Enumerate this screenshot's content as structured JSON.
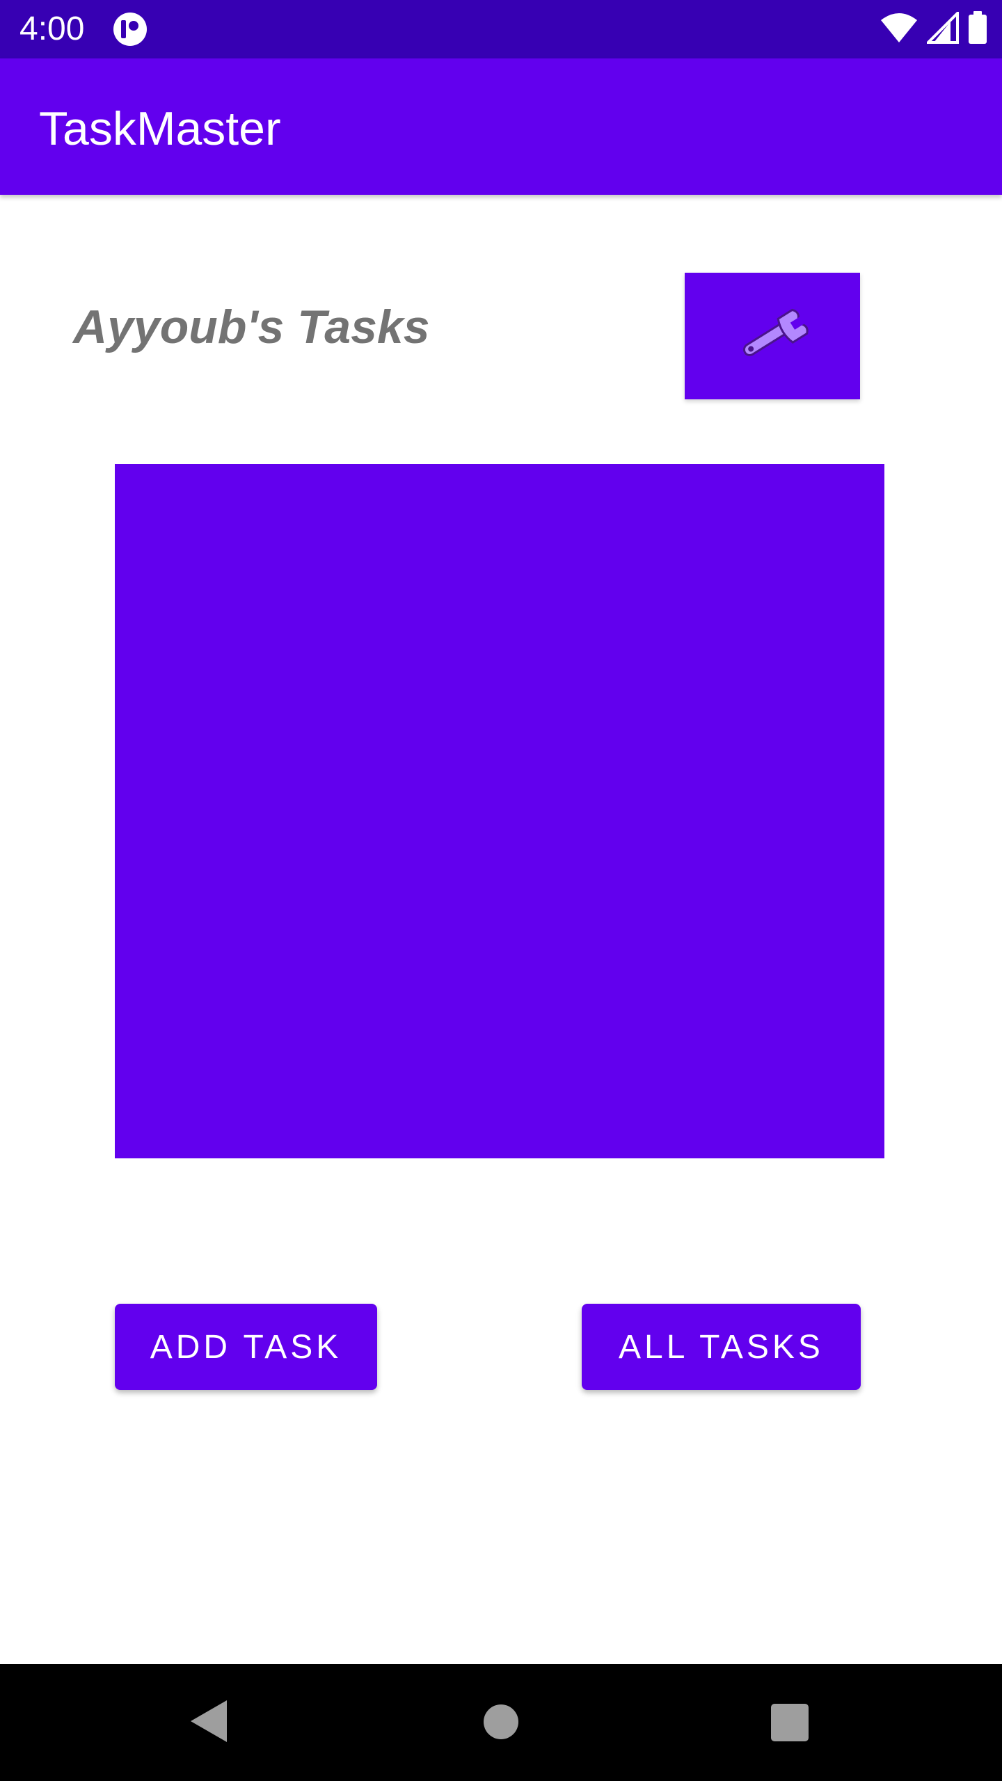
{
  "status_bar": {
    "time": "4:00",
    "background": "#3700b3",
    "icons": [
      "app-notification-icon",
      "wifi-icon",
      "cellular-signal-icon",
      "battery-icon"
    ]
  },
  "app_bar": {
    "title": "TaskMaster",
    "background": "#6200ee"
  },
  "main": {
    "heading": "Ayyoub's Tasks",
    "settings_button_icon": "wrench-icon",
    "panel_color": "#6200ee",
    "buttons": {
      "add_task": "ADD TASK",
      "all_tasks": "ALL TASKS"
    }
  },
  "nav_bar": {
    "icons": [
      "back-icon",
      "home-icon",
      "recent-apps-icon"
    ]
  },
  "colors": {
    "primary": "#6200ee",
    "primary_dark": "#3700b3",
    "heading_text": "#737373"
  }
}
